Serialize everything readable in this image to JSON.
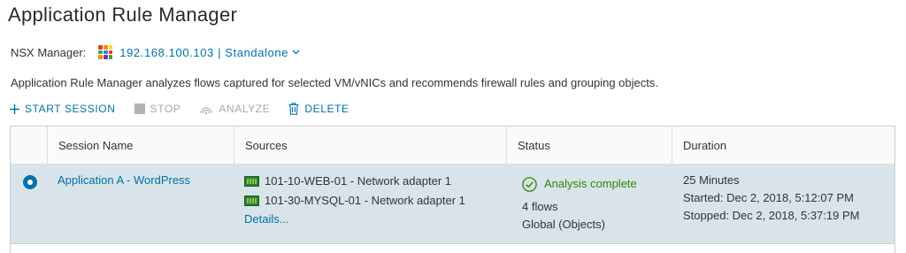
{
  "page": {
    "title": "Application Rule Manager"
  },
  "manager": {
    "label": "NSX Manager:",
    "value": "192.168.100.103 | Standalone",
    "icon": "nsx-manager-icon"
  },
  "description": "Application Rule Manager analyzes flows captured for selected VM/vNICs and recommends firewall rules and grouping objects.",
  "toolbar": {
    "start_label": "START SESSION",
    "stop_label": "STOP",
    "analyze_label": "ANALYZE",
    "delete_label": "DELETE"
  },
  "table": {
    "columns": [
      "Session Name",
      "Sources",
      "Status",
      "Duration"
    ],
    "rows": [
      {
        "selected": true,
        "session_name": "Application A - WordPress",
        "sources": [
          "101-10-WEB-01 - Network adapter 1",
          "101-30-MYSQL-01 - Network adapter 1"
        ],
        "details_link": "Details...",
        "status": "Analysis complete",
        "flows": "4 flows",
        "scope": "Global (Objects)",
        "duration": "25 Minutes",
        "started": "Started: Dec 2, 2018, 5:12:07 PM",
        "stopped": "Stopped: Dec 2, 2018, 5:37:19 PM"
      }
    ]
  },
  "colors": {
    "accent": "#0072a3",
    "success": "#318700",
    "selected_row": "#d9e4ea",
    "disabled": "#a9a9a9"
  }
}
